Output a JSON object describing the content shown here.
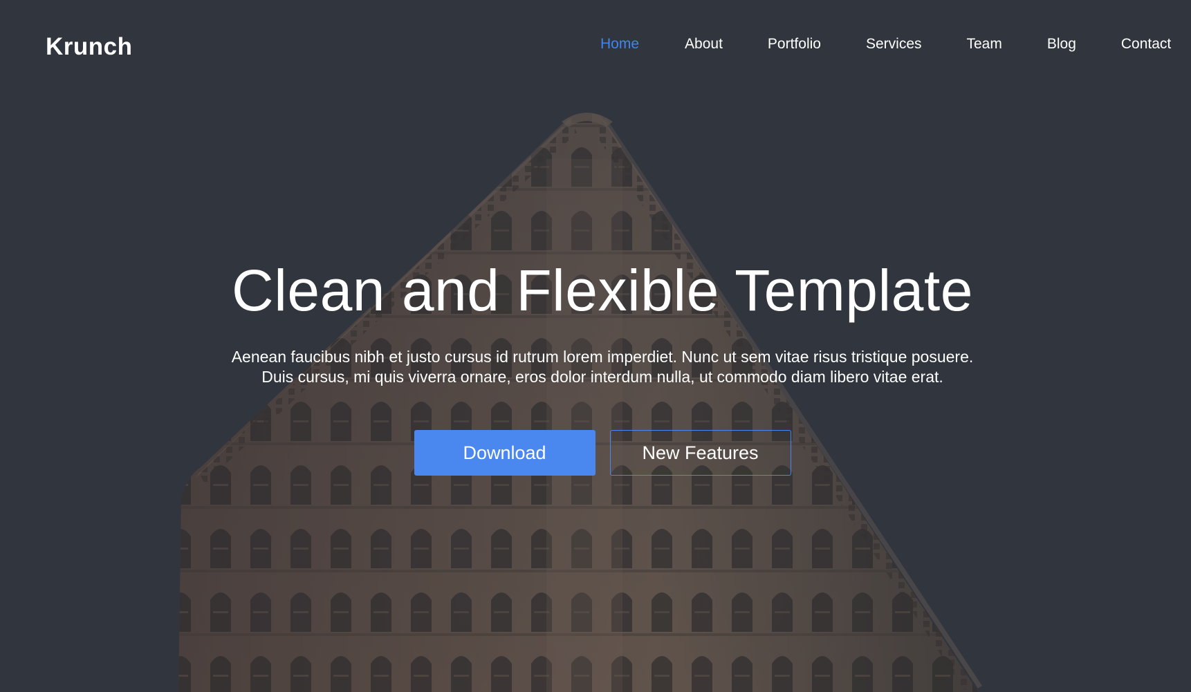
{
  "brand": {
    "name": "Krunch"
  },
  "nav": {
    "items": [
      {
        "label": "Home",
        "active": true
      },
      {
        "label": "About",
        "active": false
      },
      {
        "label": "Portfolio",
        "active": false
      },
      {
        "label": "Services",
        "active": false
      },
      {
        "label": "Team",
        "active": false
      },
      {
        "label": "Blog",
        "active": false
      },
      {
        "label": "Contact",
        "active": false
      }
    ]
  },
  "hero": {
    "title": "Clean and Flexible Template",
    "subtitle_line1": "Aenean faucibus nibh et justo cursus id rutrum lorem imperdiet. Nunc ut sem vitae risus tristique posuere.",
    "subtitle_line2": "Duis cursus, mi quis viverra ornare, eros dolor interdum nulla, ut commodo diam libero vitae erat.",
    "primary_button": "Download",
    "secondary_button": "New Features"
  },
  "colors": {
    "accent": "#4a87ee",
    "nav_active": "#3f86f0",
    "text": "#ffffff",
    "overlay": "#363a42"
  }
}
